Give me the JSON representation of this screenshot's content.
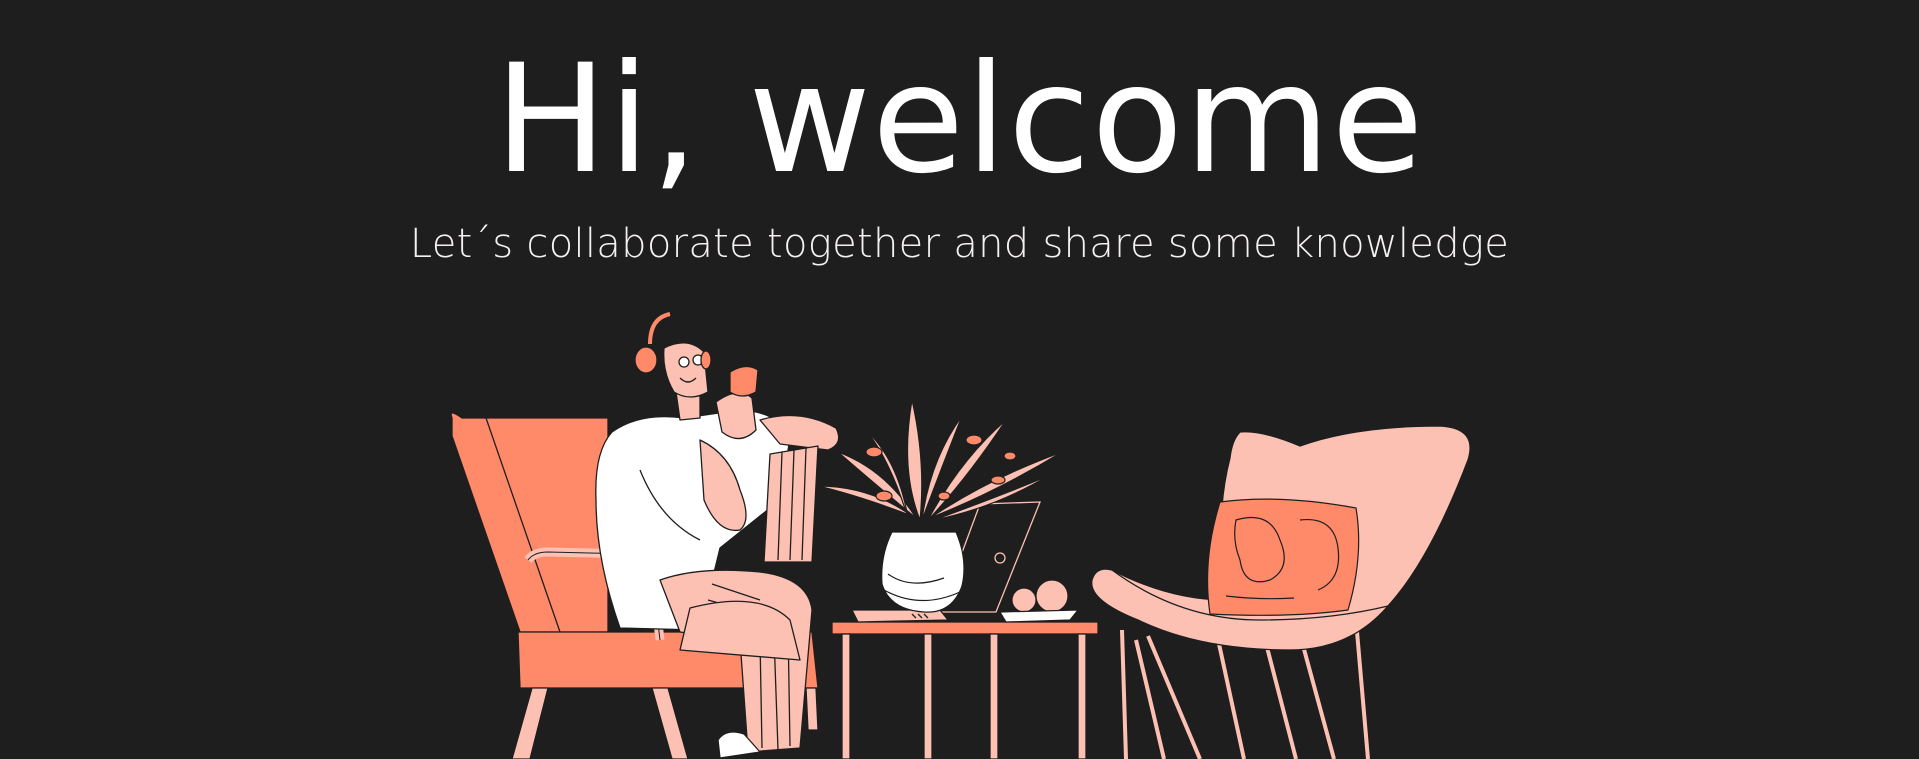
{
  "hero": {
    "title": "Hi, welcome",
    "subtitle": "Let´s collaborate together and share some knowledge"
  },
  "colors": {
    "background": "#1f1e1f",
    "coral": "#fe8a6a",
    "pink": "#fcc1b3",
    "white": "#ffffff",
    "ink": "#1f1e1f"
  },
  "illustration": {
    "elements": [
      "woman-with-headphones",
      "coffee-cup",
      "armchair",
      "side-table",
      "laptop",
      "plant-vase",
      "fruit-bowl",
      "lounge-chair",
      "cushion"
    ]
  }
}
